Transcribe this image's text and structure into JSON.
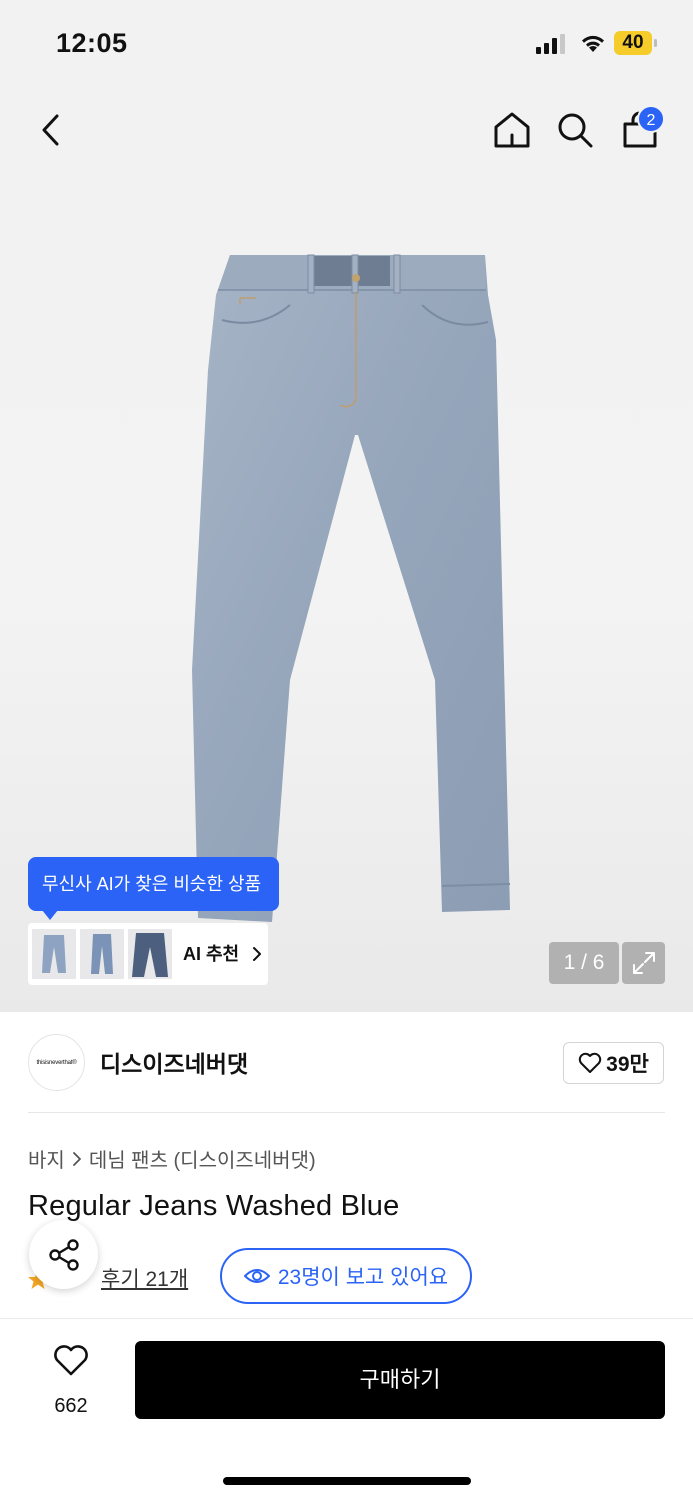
{
  "status_bar": {
    "time": "12:05",
    "battery": "40"
  },
  "nav": {
    "cart_count": "2"
  },
  "ai": {
    "tooltip": "무신사 AI가 찾은 비슷한 상품",
    "label": "AI 추천"
  },
  "gallery": {
    "pager": "1 / 6"
  },
  "brand": {
    "logo_text": "thisisneverthat®",
    "name": "디스이즈네버댓",
    "likes": "39만"
  },
  "breadcrumb": {
    "category": "바지",
    "sub": "데님 팬츠 (디스이즈네버댓)"
  },
  "product": {
    "title": "Regular Jeans Washed Blue"
  },
  "reviews": {
    "link": "후기 21개"
  },
  "viewers": {
    "text": "23명이 보고 있어요"
  },
  "bottom": {
    "like_count": "662",
    "buy_label": "구매하기"
  },
  "colors": {
    "accent": "#2b63f6",
    "buy_button": "#000000",
    "denim": "#9aaabc"
  }
}
